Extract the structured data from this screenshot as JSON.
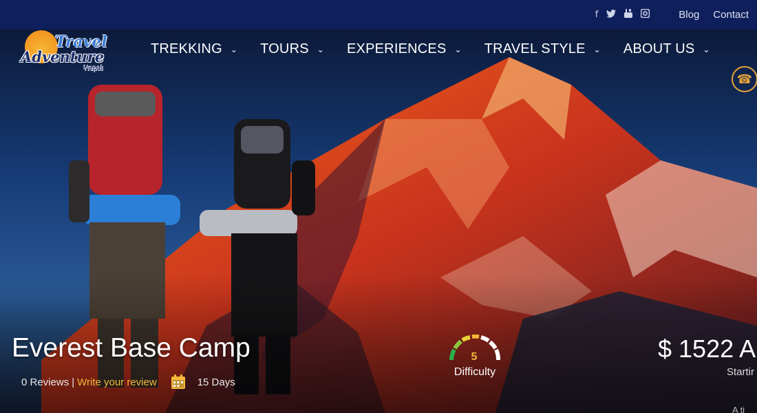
{
  "topbar": {
    "social": [
      {
        "name": "facebook",
        "glyph": "f"
      },
      {
        "name": "twitter",
        "glyph": "🐦"
      },
      {
        "name": "youtube",
        "glyph": "▶"
      },
      {
        "name": "instagram",
        "glyph": "◎"
      }
    ],
    "links": [
      "Blog",
      "Contact"
    ]
  },
  "logo": {
    "line1": "Travel",
    "line2": "Adventure",
    "line3": "Nepal"
  },
  "menu": [
    {
      "label": "TREKKING"
    },
    {
      "label": "TOURS"
    },
    {
      "label": "EXPERIENCES"
    },
    {
      "label": "TRAVEL STYLE"
    },
    {
      "label": "ABOUT US"
    }
  ],
  "icons": {
    "phone": "phone-icon",
    "chevron": "chevron-down-icon",
    "calendar": "calendar-icon"
  },
  "trip": {
    "title": "Everest Base Camp",
    "reviews": "0 Reviews",
    "separator": "|",
    "write_review": "Write your review",
    "duration": "15 Days",
    "difficulty_value": "5",
    "difficulty_label": "Difficulty",
    "price": "$ 1522 A",
    "price_sub": "Startir",
    "price_sub2": "A ti"
  },
  "colors": {
    "topbar": "#0f1f5c",
    "accent": "#f5b93a",
    "phone": "#e9a43a"
  }
}
